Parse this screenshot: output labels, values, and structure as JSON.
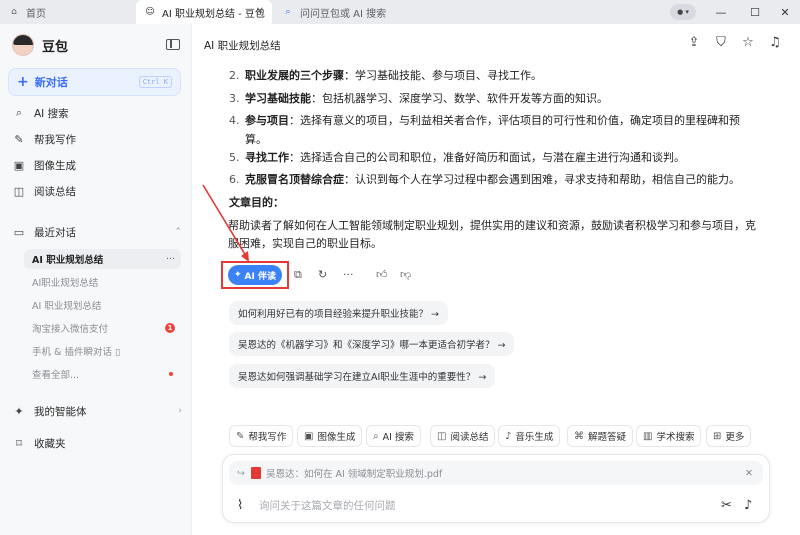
{
  "tabs": [
    {
      "label": "首页",
      "icon": "home-icon"
    },
    {
      "label": "AI 职业规划总结 - 豆包",
      "icon": "doubao-icon",
      "close": "✕"
    },
    {
      "label": "问问豆包或 AI 搜索",
      "icon": "search-icon"
    }
  ],
  "window": {
    "minimize": "—",
    "maximize": "☐",
    "close": "✕"
  },
  "sidebar": {
    "brand": "豆包",
    "new_chat": "新对话",
    "new_chat_shortcut": "Ctrl K",
    "nav": [
      {
        "label": "AI 搜索",
        "icon": "ai-search-icon"
      },
      {
        "label": "帮我写作",
        "icon": "pen-icon"
      },
      {
        "label": "图像生成",
        "icon": "image-icon"
      },
      {
        "label": "阅读总结",
        "icon": "book-icon"
      }
    ],
    "recent_title": "最近对话",
    "conversations": [
      {
        "label": "AI 职业规划总结",
        "active": true
      },
      {
        "label": "AI职业规划总结"
      },
      {
        "label": "AI 职业规划总结"
      },
      {
        "label": "淘宝接入微信支付",
        "badge": "1"
      },
      {
        "label": "手机 & 插件瞬对话 ▯"
      },
      {
        "label": "查看全部..."
      }
    ],
    "agents": "我的智能体",
    "favorites": "收藏夹"
  },
  "main": {
    "title": "AI 职业规划总结",
    "list": [
      {
        "num": "2.",
        "bold": "职业发展的三个步骤",
        "text": "：学习基础技能、参与项目、寻找工作。"
      },
      {
        "num": "3.",
        "bold": "学习基础技能",
        "text": "：包括机器学习、深度学习、数学、软件开发等方面的知识。"
      },
      {
        "num": "4.",
        "bold": "参与项目",
        "text": "：选择有意义的项目，与利益相关者合作，评估项目的可行性和价值，确定项目的里程碑和预"
      },
      {
        "num": "",
        "bold": "",
        "text": "算。"
      },
      {
        "num": "5.",
        "bold": "寻找工作",
        "text": "：选择适合自己的公司和职位，准备好简历和面试，与潜在雇主进行沟通和谈判。"
      },
      {
        "num": "6.",
        "bold": "克服冒名顶替综合症",
        "text": "：认识到每个人在学习过程中都会遇到困难，寻求支持和帮助，相信自己的能力。"
      }
    ],
    "purpose_title": "文章目的：",
    "purpose_line1": "帮助读者了解如何在人工智能领域制定职业规划，提供实用的建议和资源，鼓励读者积极学习和参与项目，克",
    "purpose_line2": "服困难，实现自己的职业目标。",
    "ai_companion": "AI 伴读",
    "suggestions": [
      "如何利用好已有的项目经验来提升职业技能？ →",
      "吴恩达的《机器学习》和《深度学习》哪一本更适合初学者？ →",
      "吴恩达如何强调基础学习在建立AI职业生涯中的重要性？ →"
    ]
  },
  "tools": [
    {
      "label": "帮我写作",
      "icon": "pen-icon"
    },
    {
      "label": "图像生成",
      "icon": "image-icon"
    },
    {
      "label": "AI 搜索",
      "icon": "ai-search-icon"
    },
    {
      "label": "阅读总结",
      "icon": "book-icon"
    },
    {
      "label": "音乐生成",
      "icon": "music-icon"
    },
    {
      "label": "解题答疑",
      "icon": "solve-icon"
    },
    {
      "label": "学术搜索",
      "icon": "chart-icon"
    },
    {
      "label": "更多",
      "icon": "more-grid-icon"
    }
  ],
  "input": {
    "reference": "吴恩达：如何在 AI 领域制定职业规划.pdf",
    "placeholder": "询问关于这篇文章的任何问题"
  },
  "colors": {
    "accent": "#3b82f6",
    "highlight_box": "#e53935"
  }
}
